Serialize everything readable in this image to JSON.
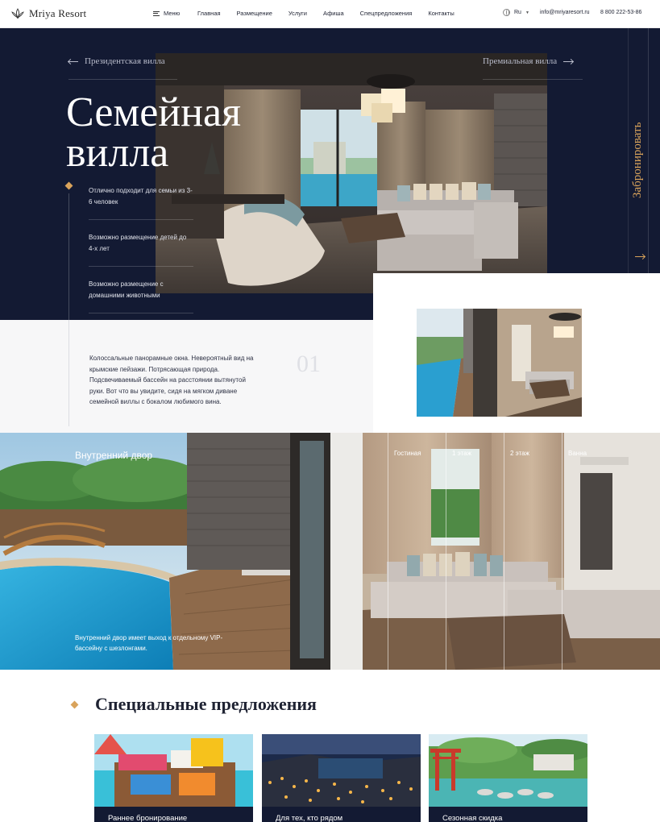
{
  "header": {
    "logo_text": "Mriya Resort",
    "menu_label": "Меню",
    "nav": [
      "Главная",
      "Размещение",
      "Услуги",
      "Афиша",
      "Спецпредложения",
      "Контакты"
    ],
    "language": "Ru",
    "email": "info@mriyaresort.ru",
    "phone": "8 800 222-53-86"
  },
  "hero": {
    "prev_label": "Президентская вилла",
    "next_label": "Премиальная вилла",
    "title_line1": "Семейная",
    "title_line2": "вилла",
    "features": [
      "Отлично подходит для семьи из 3-6 человек",
      "Возможно размещение детей до 4-х лет",
      "Возможно размещение с домашними животными"
    ],
    "book_label": "Забронировать"
  },
  "info": {
    "text": "Колоссальные панорамные окна. Невероятный вид на крымские пейзажи. Потрясающая природа. Подсвечиваемый бассейн на расстоянии вытянутой руки.  Вот что вы увидите, сидя на мягком диване семейной виллы с бокалом любимого вина.",
    "number": "01"
  },
  "courtyard": {
    "title": "Внутренний двор",
    "text": "Внутренний двор имеет выход к отдельному VIP-бассейну с шезлонгами.",
    "tabs": [
      "Гостиная",
      "1 этаж",
      "2 этаж",
      "Ванна"
    ]
  },
  "offers": {
    "title": "Специальные предложения",
    "items": [
      "Раннее бронирование",
      "Для тех, кто рядом",
      "Сезонная скидка"
    ]
  },
  "colors": {
    "navy": "#131a33",
    "gold": "#d9a35b"
  }
}
